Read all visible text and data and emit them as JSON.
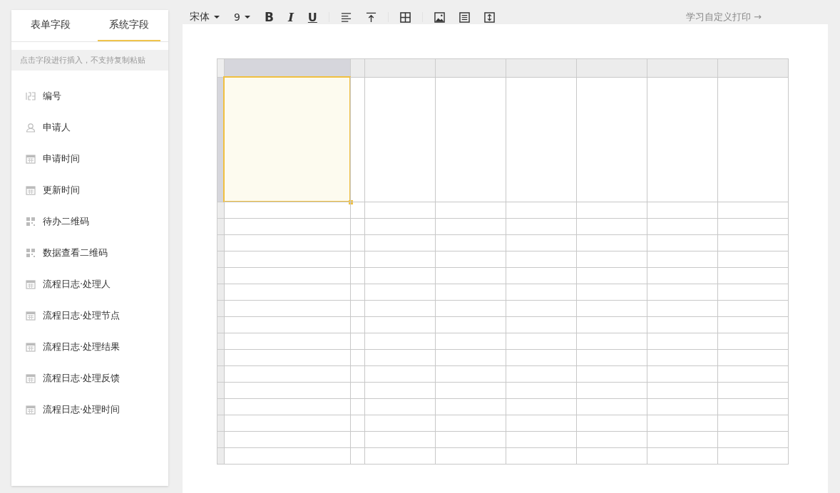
{
  "sidebar": {
    "tabs": [
      {
        "label": "表单字段",
        "selected": false
      },
      {
        "label": "系统字段",
        "selected": true
      }
    ],
    "hint": "点击字段进行插入，不支持复制粘贴",
    "items": [
      {
        "label": "编号",
        "kind": "number"
      },
      {
        "label": "申请人",
        "kind": "person"
      },
      {
        "label": "申请时间",
        "kind": "date"
      },
      {
        "label": "更新时间",
        "kind": "date"
      },
      {
        "label": "待办二维码",
        "kind": "qrcode"
      },
      {
        "label": "数据查看二维码",
        "kind": "qrcode"
      },
      {
        "label": "流程日志·处理人",
        "kind": "log"
      },
      {
        "label": "流程日志·处理节点",
        "kind": "log"
      },
      {
        "label": "流程日志·处理结果",
        "kind": "log"
      },
      {
        "label": "流程日志·处理反馈",
        "kind": "log"
      },
      {
        "label": "流程日志·处理时间",
        "kind": "log"
      }
    ]
  },
  "toolbar": {
    "font": "宋体",
    "size": "9",
    "bold": "B",
    "italic": "I",
    "underline": "U",
    "help_link": "学习自定义打印 →"
  },
  "grid": {
    "columns": [
      {
        "kind": "wide",
        "selected": true
      },
      {
        "kind": "narrow",
        "selected": false
      },
      {
        "kind": "normal",
        "selected": false
      },
      {
        "kind": "normal",
        "selected": false
      },
      {
        "kind": "normal",
        "selected": false
      },
      {
        "kind": "normal",
        "selected": false
      },
      {
        "kind": "normal",
        "selected": false
      },
      {
        "kind": "normal",
        "selected": false
      }
    ],
    "rows": [
      {
        "kind": "tall",
        "selected": true
      },
      {
        "kind": "normal",
        "selected": false
      },
      {
        "kind": "normal",
        "selected": false
      },
      {
        "kind": "normal",
        "selected": false
      },
      {
        "kind": "normal",
        "selected": false
      },
      {
        "kind": "normal",
        "selected": false
      },
      {
        "kind": "normal",
        "selected": false
      },
      {
        "kind": "normal",
        "selected": false
      },
      {
        "kind": "normal",
        "selected": false
      },
      {
        "kind": "normal",
        "selected": false
      },
      {
        "kind": "normal",
        "selected": false
      },
      {
        "kind": "normal",
        "selected": false
      },
      {
        "kind": "normal",
        "selected": false
      },
      {
        "kind": "normal",
        "selected": false
      },
      {
        "kind": "normal",
        "selected": false
      },
      {
        "kind": "normal",
        "selected": false
      },
      {
        "kind": "normal",
        "selected": false
      }
    ]
  }
}
